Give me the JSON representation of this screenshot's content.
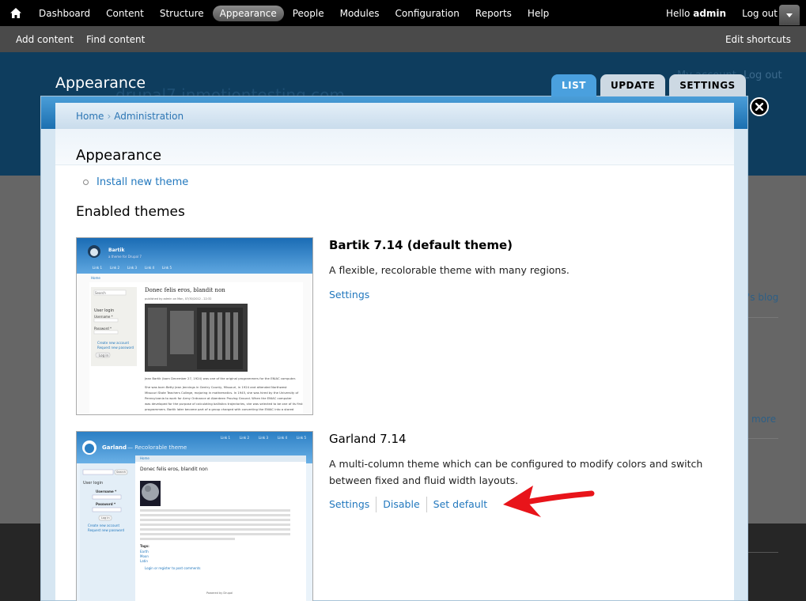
{
  "toolbar": {
    "items": [
      "Dashboard",
      "Content",
      "Structure",
      "Appearance",
      "People",
      "Modules",
      "Configuration",
      "Reports",
      "Help"
    ],
    "active": "Appearance",
    "hello_prefix": "Hello",
    "username": "admin",
    "logout": "Log out"
  },
  "shortcuts": {
    "items": [
      "Add content",
      "Find content"
    ],
    "edit": "Edit shortcuts"
  },
  "background": {
    "title": "Appearance",
    "site_name": "drupal7.inmotiontesting.com",
    "my_account": "My account",
    "logout": "Log out",
    "blog_link": "'s blog",
    "more_link": "more"
  },
  "tabs": [
    "LIST",
    "UPDATE",
    "SETTINGS"
  ],
  "active_tab": "LIST",
  "breadcrumb": [
    "Home",
    "Administration"
  ],
  "breadcrumb_sep": "›",
  "page_title": "Appearance",
  "action_link": "Install new theme",
  "enabled_heading": "Enabled themes",
  "themes": [
    {
      "name": "Bartik 7.14 (default theme)",
      "description": "A flexible, recolorable theme with many regions.",
      "links": [
        "Settings"
      ],
      "screenshot": {
        "site": "Bartik",
        "slogan": "a theme for Drupal 7",
        "nav": [
          "Link 1",
          "Link 2",
          "Link 3",
          "Link 4",
          "Link 5"
        ],
        "home": "Home",
        "search": "Search",
        "user_login": "User login",
        "username": "Username *",
        "password": "Password *",
        "create": "Create new account",
        "request": "Request new password",
        "login_btn": "Log in",
        "article_title": "Donec felis eros, blandit non",
        "meta": "published by admin on Mon, 07/30/2012 - 22:32",
        "body1": "Jean Bartik (born December 27, 1924) was one of the original programmers for the ENIAC computer.",
        "body2": "She was born Betty Jean Jennings in Gentry County, Missouri, in 1924 and attended Northwest",
        "body3": "Missouri State Teachers College, majoring in mathematics. In 1945, she was hired by the University of",
        "body4": "Pennsylvania to work for Army Ordnance at Aberdeen Proving Ground. When the ENIAC computer",
        "body5": "was developed for the purpose of calculating ballistics trajectories, she was selected to be one of its first",
        "body6": "programmers. Bartik later became part of a group charged with converting the ENIAC into a stored"
      }
    },
    {
      "name": "Garland 7.14",
      "description": "A multi-column theme which can be configured to modify colors and switch between fixed and fluid width layouts.",
      "links": [
        "Settings",
        "Disable",
        "Set default"
      ],
      "screenshot": {
        "site": "Garland",
        "slogan": "— Recolorable theme",
        "nav": [
          "Link 1",
          "Link 2",
          "Link 3",
          "Link 4",
          "Link 5"
        ],
        "home": "Home",
        "search": "Search",
        "user_login": "User login",
        "username": "Username *",
        "password": "Password *",
        "login_btn": "Log in",
        "create": "Create new account",
        "request": "Request new password",
        "article_title": "Donec felis eros, blandit non",
        "tags_label": "Tags:",
        "tags": [
          "Earth",
          "Moon",
          "Latin"
        ],
        "login_note": "Login or register to post comments",
        "powered": "Powered by Drupal"
      }
    }
  ],
  "colors": {
    "accent": "#2278be",
    "tab_active": "#4aa0de",
    "arrow": "#e8141a"
  }
}
